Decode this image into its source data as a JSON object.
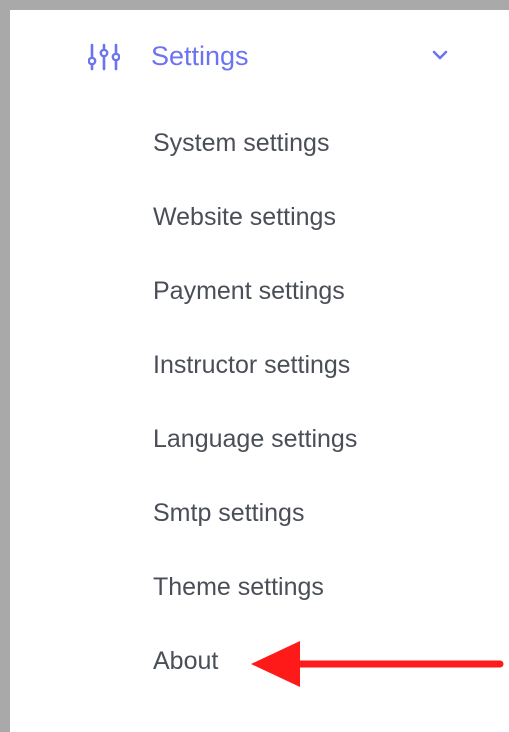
{
  "menu": {
    "title": "Settings",
    "icon": "sliders-icon",
    "expand_icon": "chevron-down-icon",
    "accent_color": "#6b73f2"
  },
  "submenu": {
    "items": [
      {
        "label": "System settings"
      },
      {
        "label": "Website settings"
      },
      {
        "label": "Payment settings"
      },
      {
        "label": "Instructor settings"
      },
      {
        "label": "Language settings"
      },
      {
        "label": "Smtp settings"
      },
      {
        "label": "Theme settings"
      },
      {
        "label": "About"
      }
    ],
    "text_color": "#4a4f57"
  },
  "annotation": {
    "icon": "red-arrow-icon",
    "color": "#ff1a1a",
    "points_to": "About"
  }
}
